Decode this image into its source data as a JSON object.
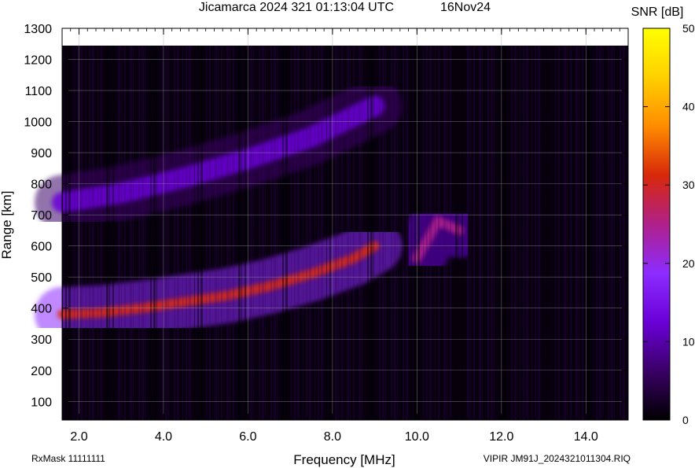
{
  "chart_data": {
    "type": "heatmap",
    "title": "Jicamarca 2024 321 01:13:04 UTC",
    "date": "16Nov24",
    "xlabel": "Frequency [MHz]",
    "ylabel": "Range [km]",
    "xlim": [
      1.6,
      15.0
    ],
    "ylim": [
      40,
      1300
    ],
    "xticks": [
      "2.0",
      "4.0",
      "6.0",
      "8.0",
      "10.0",
      "12.0",
      "14.0"
    ],
    "yticks": [
      "100",
      "200",
      "300",
      "400",
      "500",
      "600",
      "700",
      "800",
      "900",
      "1000",
      "1100",
      "1200",
      "1300"
    ],
    "colorbar": {
      "label": "SNR [dB]",
      "range": [
        0,
        50
      ],
      "ticks": [
        "0",
        "10",
        "20",
        "30",
        "40",
        "50"
      ],
      "colors": [
        "#000000",
        "#3a0066",
        "#6a00d8",
        "#8c2cff",
        "#b0208a",
        "#d8280a",
        "#ff8c00",
        "#ffd000",
        "#ffff00"
      ]
    },
    "traces": [
      {
        "x": [
          1.6,
          2.5,
          3.5,
          4.5,
          5.5,
          6.5,
          7.5,
          8.5,
          9.0
        ],
        "y": [
          380,
          385,
          400,
          420,
          440,
          470,
          510,
          560,
          600
        ],
        "snr": 30
      },
      {
        "x": [
          10.0,
          10.5,
          11.0
        ],
        "y": [
          560,
          680,
          650
        ],
        "snr": 28
      },
      {
        "x": [
          1.6,
          3.0,
          4.5,
          6.0,
          7.5,
          9.0
        ],
        "y": [
          740,
          770,
          820,
          880,
          950,
          1050
        ],
        "snr": 12
      }
    ],
    "rxmask": "RxMask 11111111",
    "filename": "VIPIR  JM91J_2024321011304.RIQ"
  }
}
